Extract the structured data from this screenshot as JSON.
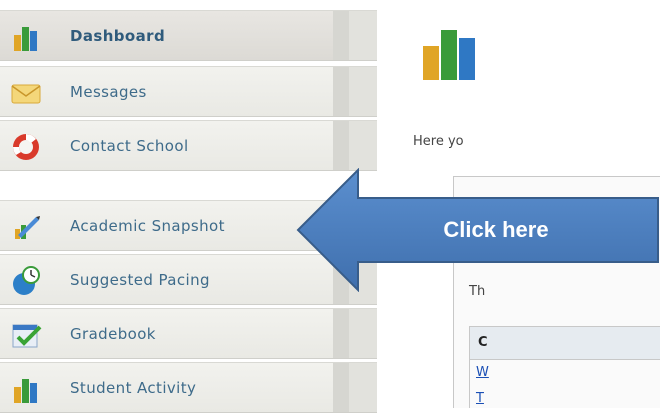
{
  "sidebar": {
    "items": [
      {
        "label": "Dashboard",
        "icon": "bar-chart-icon",
        "active": true
      },
      {
        "label": "Messages",
        "icon": "envelope-icon"
      },
      {
        "label": "Contact School",
        "icon": "lifebuoy-icon"
      },
      {
        "label": "Academic Snapshot",
        "icon": "pencil-chart-icon"
      },
      {
        "label": "Suggested Pacing",
        "icon": "clock-globe-icon"
      },
      {
        "label": "Gradebook",
        "icon": "checkmark-icon"
      },
      {
        "label": "Student Activity",
        "icon": "bar-chart-icon"
      }
    ]
  },
  "content": {
    "intro": "Here yo",
    "panel_text": "Th",
    "grid_head": "C",
    "link1": "W",
    "link2": "T"
  },
  "callout": {
    "label": "Click here",
    "fill_color": "#4f81bd",
    "stroke_color": "#385d8a"
  }
}
